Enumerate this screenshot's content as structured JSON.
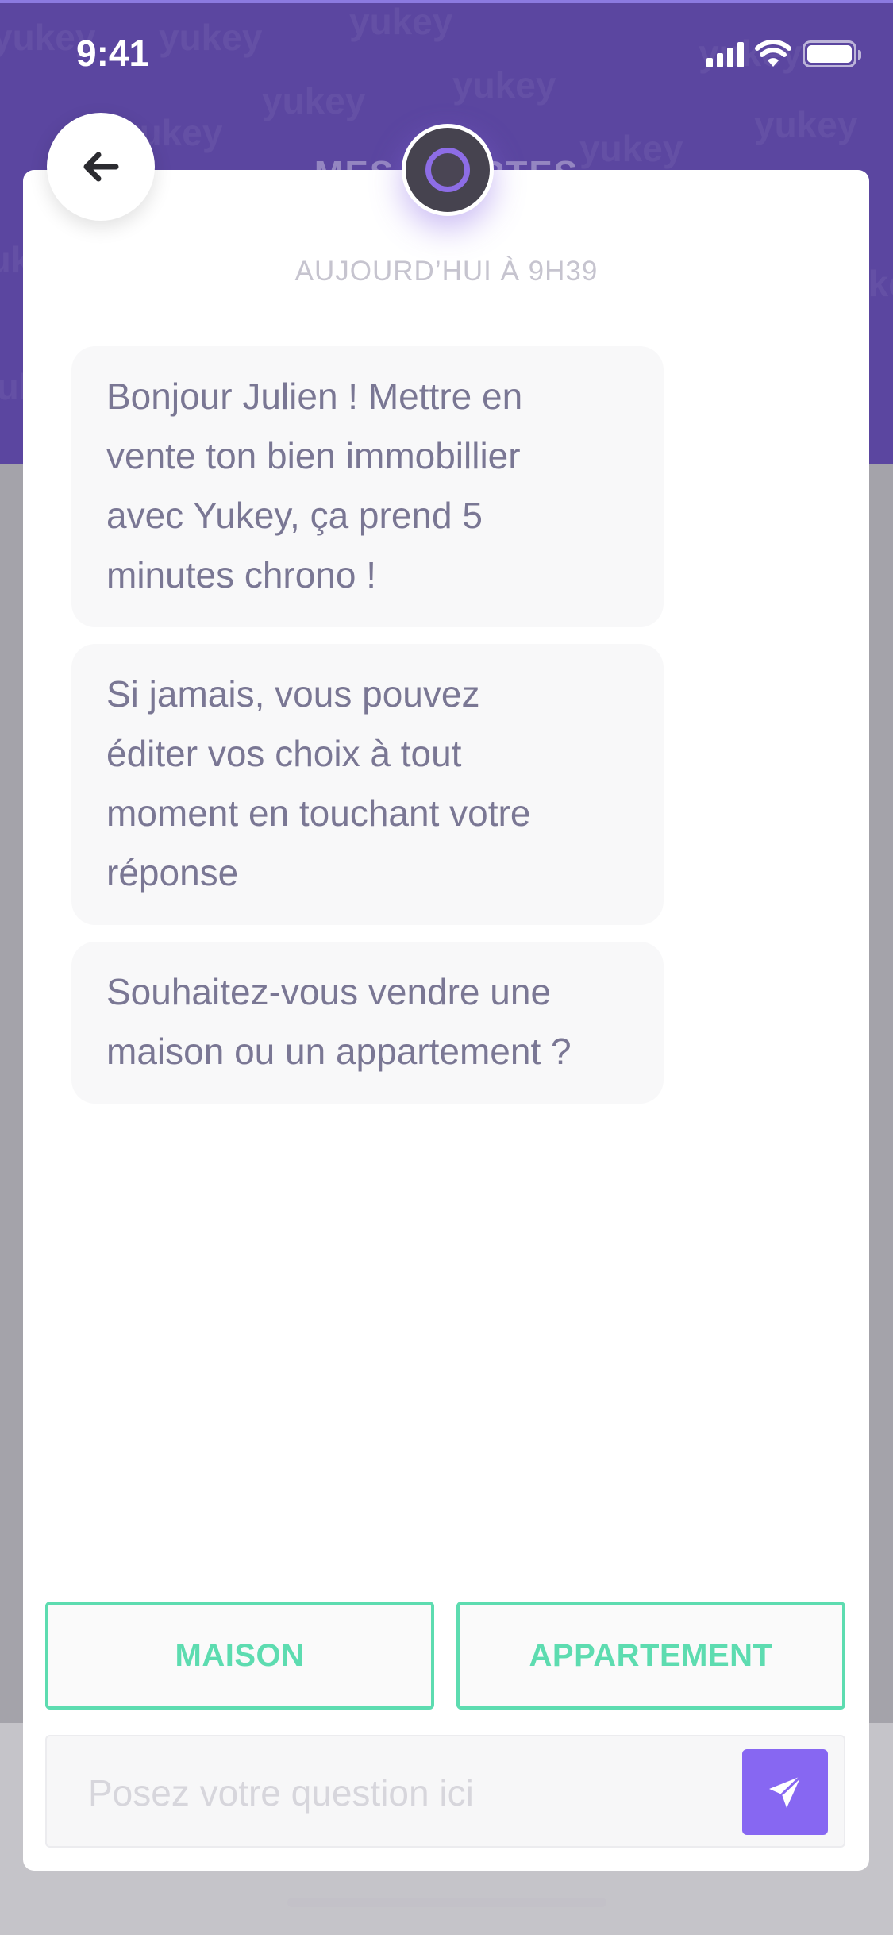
{
  "status_bar": {
    "time": "9:41",
    "icons": [
      "cellular-signal-icon",
      "wifi-icon",
      "battery-icon"
    ]
  },
  "header": {
    "title": "MES ALERTES",
    "watermark": "yukey"
  },
  "colors": {
    "header_purple": "#5b46a0",
    "accent_purple": "#8767f2",
    "choice_green": "#5ddcb0",
    "bubble_text": "#7a7794"
  },
  "chat": {
    "timestamp": "AUJOURD’HUI À 9H39",
    "messages": [
      {
        "lines": [
          "Bonjour Julien ! Mettre en",
          "vente ton bien immobillier",
          "avec Yukey, ça prend 5",
          "minutes chrono !"
        ]
      },
      {
        "lines": [
          "Si jamais, vous pouvez",
          "éditer vos choix à tout",
          "moment en touchant votre",
          "réponse"
        ]
      },
      {
        "lines": [
          "Souhaitez-vous vendre une",
          "maison ou un appartement ?"
        ]
      }
    ]
  },
  "choices": {
    "option1": "MAISON",
    "option2": "APPARTEMENT"
  },
  "composer": {
    "placeholder": "Posez votre question ici",
    "value": ""
  }
}
